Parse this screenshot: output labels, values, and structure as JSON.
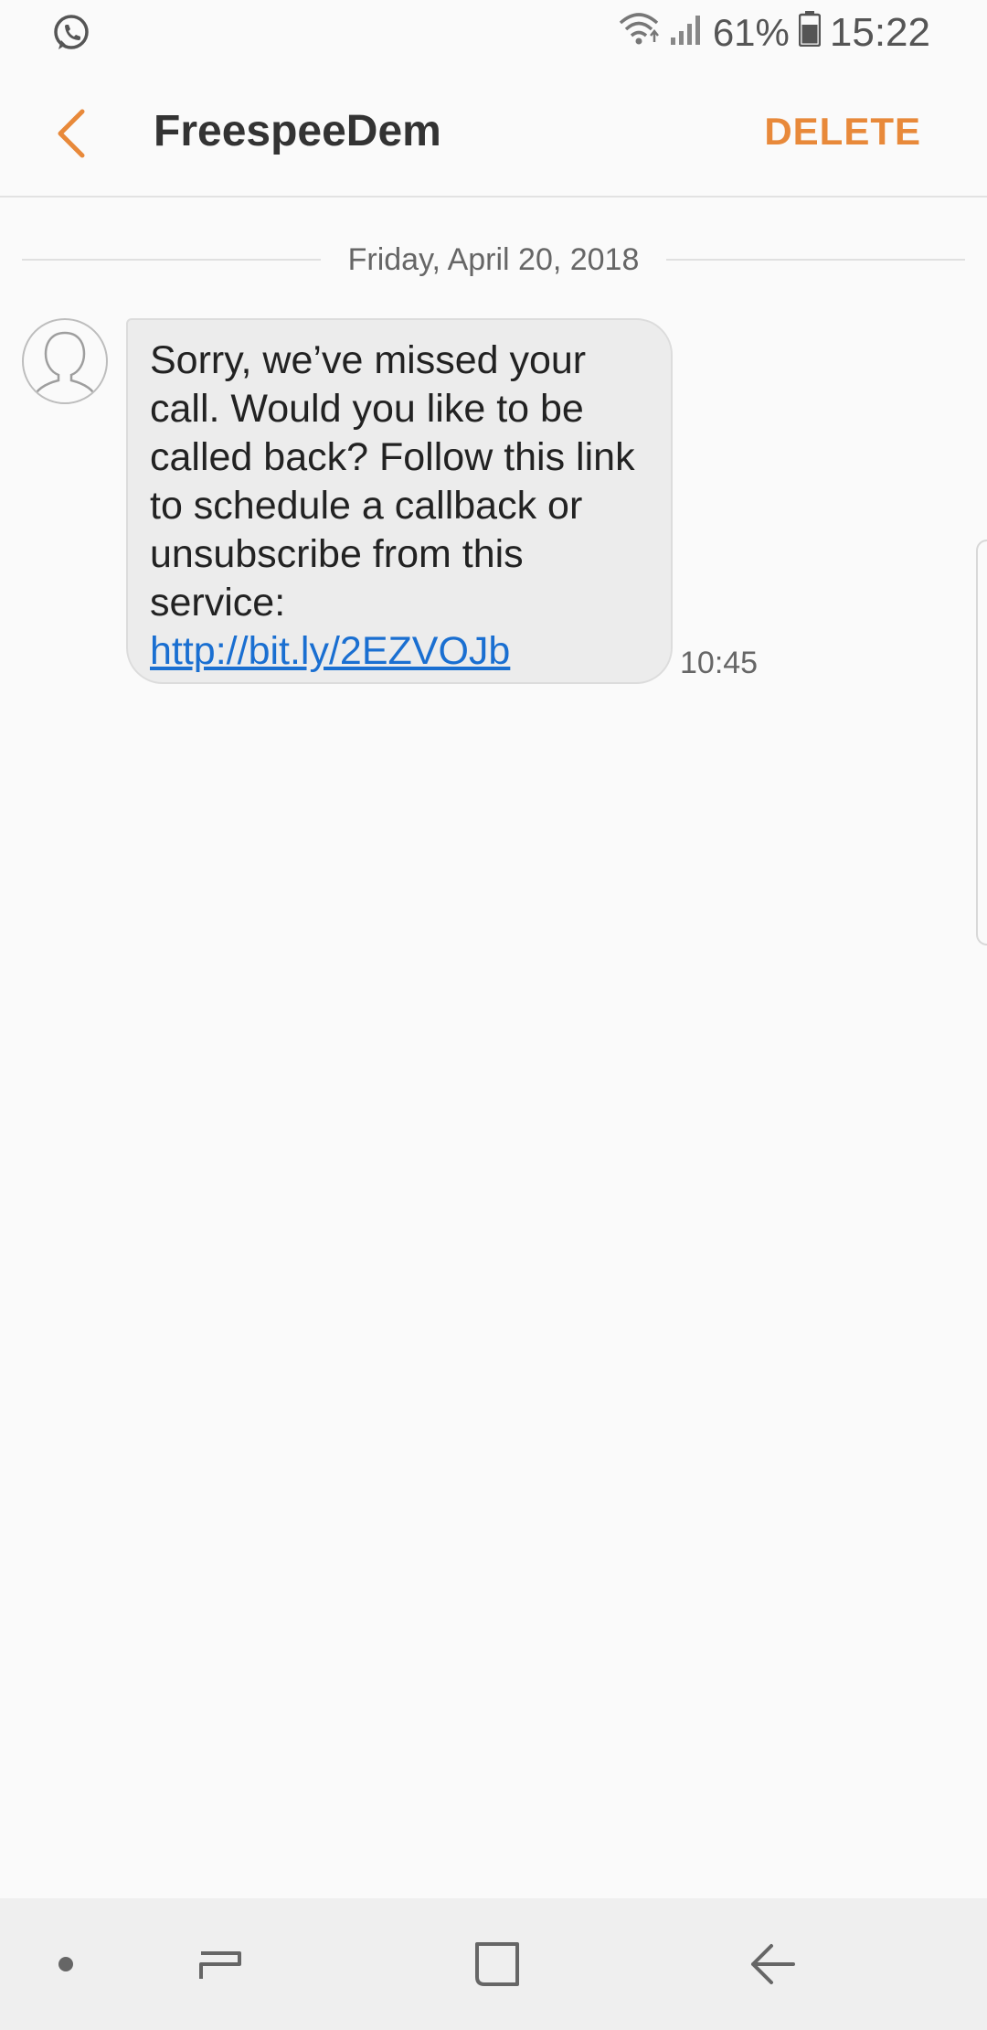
{
  "status_bar": {
    "battery_percent": "61%",
    "time": "15:22",
    "icons": [
      "whatsapp-icon",
      "wifi-icon",
      "signal-icon",
      "battery-icon"
    ]
  },
  "header": {
    "title": "FreespeeDem",
    "delete_label": "DELETE",
    "accent_color": "#e8893a"
  },
  "conversation": {
    "date": "Friday, April 20, 2018",
    "messages": [
      {
        "text": "Sorry, we’ve missed your call. Would you like to be called back? Follow this link to schedule a callback or unsubscribe from this service:",
        "link": "http://bit.ly/2EZVOJb",
        "time": "10:45"
      }
    ]
  },
  "nav_bar": {
    "buttons": [
      "dot-icon",
      "recent-apps-icon",
      "home-icon",
      "back-icon"
    ]
  }
}
